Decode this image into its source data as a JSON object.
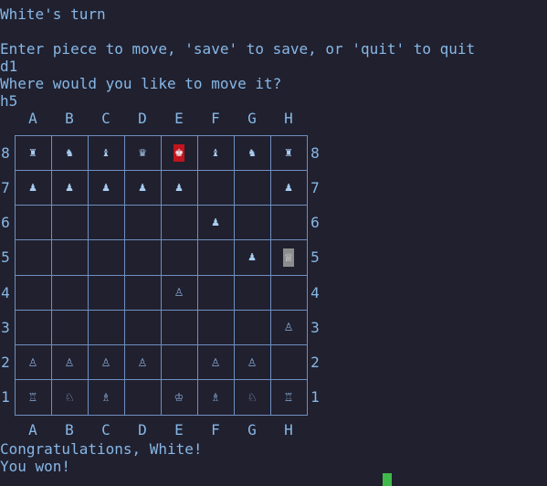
{
  "terminal": {
    "turn_line": "White's turn",
    "prompt_line": "Enter piece to move, 'save' to save, or 'quit' to quit",
    "input_from": "d1",
    "move_prompt": "Where would you like to move it?",
    "input_to": "h5",
    "congrats": "Congratulations, White!",
    "won": "You won!",
    "cursor_color": "#3fb94a"
  },
  "board": {
    "columns": [
      "A",
      "B",
      "C",
      "D",
      "E",
      "F",
      "G",
      "H"
    ],
    "rows": [
      "8",
      "7",
      "6",
      "5",
      "4",
      "3",
      "2",
      "1"
    ],
    "squares": [
      [
        {
          "piece": "♜",
          "side": "black"
        },
        {
          "piece": "♞",
          "side": "black"
        },
        {
          "piece": "♝",
          "side": "black"
        },
        {
          "piece": "♛",
          "side": "black"
        },
        {
          "piece": "♚",
          "side": "black",
          "highlight": "red"
        },
        {
          "piece": "♝",
          "side": "black"
        },
        {
          "piece": "♞",
          "side": "black"
        },
        {
          "piece": "♜",
          "side": "black"
        }
      ],
      [
        {
          "piece": "♟",
          "side": "black"
        },
        {
          "piece": "♟",
          "side": "black"
        },
        {
          "piece": "♟",
          "side": "black"
        },
        {
          "piece": "♟",
          "side": "black"
        },
        {
          "piece": "♟",
          "side": "black"
        },
        {
          "piece": "",
          "side": ""
        },
        {
          "piece": "",
          "side": ""
        },
        {
          "piece": "♟",
          "side": "black"
        }
      ],
      [
        {
          "piece": "",
          "side": ""
        },
        {
          "piece": "",
          "side": ""
        },
        {
          "piece": "",
          "side": ""
        },
        {
          "piece": "",
          "side": ""
        },
        {
          "piece": "",
          "side": ""
        },
        {
          "piece": "♟",
          "side": "black"
        },
        {
          "piece": "",
          "side": ""
        },
        {
          "piece": "",
          "side": ""
        }
      ],
      [
        {
          "piece": "",
          "side": ""
        },
        {
          "piece": "",
          "side": ""
        },
        {
          "piece": "",
          "side": ""
        },
        {
          "piece": "",
          "side": ""
        },
        {
          "piece": "",
          "side": ""
        },
        {
          "piece": "",
          "side": ""
        },
        {
          "piece": "♟",
          "side": "black"
        },
        {
          "piece": "♕",
          "side": "white",
          "highlight": "gray"
        }
      ],
      [
        {
          "piece": "",
          "side": ""
        },
        {
          "piece": "",
          "side": ""
        },
        {
          "piece": "",
          "side": ""
        },
        {
          "piece": "",
          "side": ""
        },
        {
          "piece": "♙",
          "side": "white"
        },
        {
          "piece": "",
          "side": ""
        },
        {
          "piece": "",
          "side": ""
        },
        {
          "piece": "",
          "side": ""
        }
      ],
      [
        {
          "piece": "",
          "side": ""
        },
        {
          "piece": "",
          "side": ""
        },
        {
          "piece": "",
          "side": ""
        },
        {
          "piece": "",
          "side": ""
        },
        {
          "piece": "",
          "side": ""
        },
        {
          "piece": "",
          "side": ""
        },
        {
          "piece": "",
          "side": ""
        },
        {
          "piece": "♙",
          "side": "white"
        }
      ],
      [
        {
          "piece": "♙",
          "side": "white"
        },
        {
          "piece": "♙",
          "side": "white"
        },
        {
          "piece": "♙",
          "side": "white"
        },
        {
          "piece": "♙",
          "side": "white"
        },
        {
          "piece": "",
          "side": ""
        },
        {
          "piece": "♙",
          "side": "white"
        },
        {
          "piece": "♙",
          "side": "white"
        },
        {
          "piece": "",
          "side": ""
        }
      ],
      [
        {
          "piece": "♖",
          "side": "white"
        },
        {
          "piece": "♘",
          "side": "white"
        },
        {
          "piece": "♗",
          "side": "white"
        },
        {
          "piece": "",
          "side": ""
        },
        {
          "piece": "♔",
          "side": "white"
        },
        {
          "piece": "♗",
          "side": "white"
        },
        {
          "piece": "♘",
          "side": "white"
        },
        {
          "piece": "♖",
          "side": "white"
        }
      ]
    ]
  }
}
